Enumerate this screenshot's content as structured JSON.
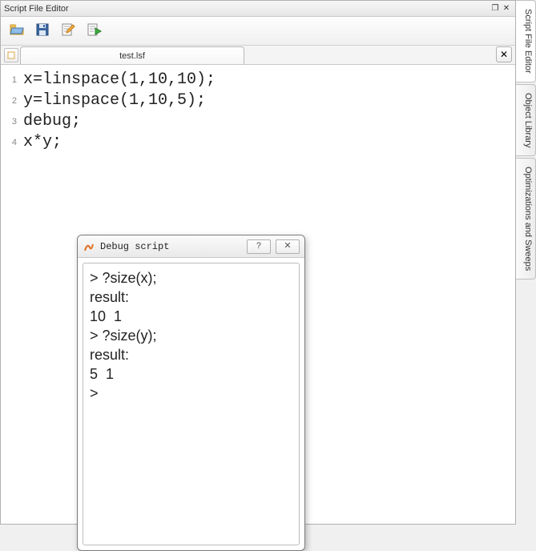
{
  "window": {
    "title": "Script File Editor"
  },
  "toolbar": {
    "open_tooltip": "Open",
    "save_tooltip": "Save",
    "edit_tooltip": "Edit",
    "run_tooltip": "Run"
  },
  "tab": {
    "filename": "test.lsf"
  },
  "code": {
    "lines": [
      "x=linspace(1,10,10);",
      "y=linspace(1,10,5);",
      "debug;",
      "x*y;"
    ]
  },
  "debug_dialog": {
    "title": "Debug script",
    "output": "> ?size(x);\nresult: \n10  1  \n> ?size(y);\nresult: \n5  1  \n> "
  },
  "side_tabs": {
    "items": [
      "Script File Editor",
      "Object Library",
      "Optimizations and Sweeps"
    ]
  }
}
